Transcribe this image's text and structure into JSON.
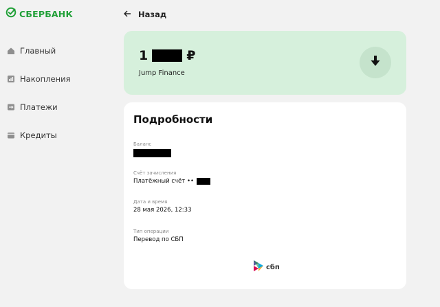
{
  "brand": {
    "name": "СБЕРБАНК",
    "color": "#21a038"
  },
  "sidebar": {
    "items": [
      {
        "label": "Главный",
        "icon": "home-icon"
      },
      {
        "label": "Накопления",
        "icon": "savings-chart-icon"
      },
      {
        "label": "Платежи",
        "icon": "transfer-icon"
      },
      {
        "label": "Кредиты",
        "icon": "wallet-icon"
      }
    ]
  },
  "header": {
    "back_label": "Назад",
    "back_icon": "arrow-left-icon"
  },
  "amount_card": {
    "amount_prefix": "1",
    "currency": "₽",
    "merchant": "Jump Finance",
    "action_icon": "download-icon",
    "bg_color": "#d6f0dc"
  },
  "details": {
    "title": "Подробности",
    "balance_label": "Баланс",
    "account_label": "Счёт зачисления",
    "account_value": "Платёжный счёт ••",
    "datetime_label": "Дата и время",
    "datetime_value": "28 мая 2026, 12:33",
    "operation_label": "Тип операции",
    "operation_value": "Перевод по СБП",
    "sbp_logo_text": "сбп"
  }
}
